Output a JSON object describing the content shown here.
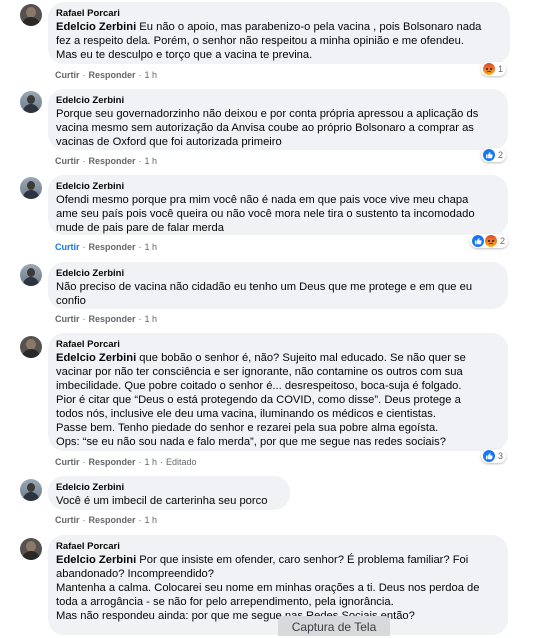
{
  "comments": [
    {
      "author": "Rafael Porcari",
      "mention": "Edelcio Zerbini",
      "text": " Eu não o apoio, mas parabenizo-o pela vacina , pois Bolsonaro nada\nfez a respeito dela. Porém, o senhor não respeitou a minha opinião e me ofendeu.\nMas eu te desculpo e torço que a vacina te previna.",
      "like": "Curtir",
      "reply": "Responder",
      "time": "1 h",
      "reactions": [
        "angry-icon"
      ],
      "reaction_count": "1"
    },
    {
      "author": "Edelcio Zerbini",
      "mention": "",
      "text": "Porque seu governadorzinho não deixou e por conta própria apressou a aplicação ds\nvacina mesmo sem autorização da Anvisa coube ao próprio Bolsonaro a comprar as\nvacinas de Oxford que foi autorizada primeiro",
      "like": "Curtir",
      "reply": "Responder",
      "time": "1 h",
      "reactions": [
        "like-icon"
      ],
      "reaction_count": "2"
    },
    {
      "author": "Edelcio Zerbini",
      "mention": "",
      "text": "Ofendi mesmo porque pra mim você não é nada em que pais voce vive meu chapa\name seu país pois você queira ou não você mora nele tira o sustento ta incomodado\nmude de pais pare de falar merda",
      "like": "Curtir",
      "reply": "Responder",
      "time": "1 h",
      "reactions": [
        "like-icon",
        "angry-icon"
      ],
      "reaction_count": "2"
    },
    {
      "author": "Edelcio Zerbini",
      "mention": "",
      "text": "Não preciso de vacina não cidadão eu tenho um Deus que me protege e em que eu\nconfio",
      "like": "Curtir",
      "reply": "Responder",
      "time": "1 h",
      "reactions": [],
      "reaction_count": ""
    },
    {
      "author": "Rafael Porcari",
      "mention": "Edelcio Zerbini",
      "text": " que bobão o senhor é, não? Sujeito mal educado. Se não quer se\nvacinar por não ter consciência e ser ignorante, não contamine os outros com sua\nimbecilidade. Que pobre coitado o senhor é... desrespeitoso, boca-suja é folgado.\nPior é citar que “Deus o está protegendo da COVID, como disse”. Deus protege a\ntodos nós, inclusive ele deu uma vacina, iluminando os médicos e cientistas.\nPasse bem. Tenho piedade do senhor e rezarei pela sua pobre alma egoísta.\nOps: “se eu não sou nada e falo merda”, por que me segue nas redes sociais?",
      "like": "Curtir",
      "reply": "Responder",
      "time": "1 h",
      "edited": "Editado",
      "reactions": [
        "like-icon"
      ],
      "reaction_count": "3"
    },
    {
      "author": "Edelcio Zerbini",
      "mention": "",
      "text": "Você é um imbecil de carterinha seu porco",
      "like": "Curtir",
      "reply": "Responder",
      "time": "1 h",
      "reactions": [],
      "reaction_count": ""
    },
    {
      "author": "Rafael Porcari",
      "mention": "Edelcio Zerbini",
      "text": " Por que insiste em ofender, caro senhor? É problema familiar? Foi\nabandonado? Incompreendido?\nMantenha a calma. Colocarei seu nome em minhas orações a ti. Deus nos perdoa de\ntoda a arrogância - se não for pelo arrependimento, pela ignorância.\nMas não respondeu ainda: por que me segue nas Redes Sociais então?",
      "like": "",
      "reply": "",
      "time": "",
      "reactions": [],
      "reaction_count": ""
    }
  ],
  "toast": "Captura de Tela",
  "colors": {
    "bubble": "#f0f2f5",
    "meta": "#65676b",
    "like_blue": "#1877f2"
  }
}
